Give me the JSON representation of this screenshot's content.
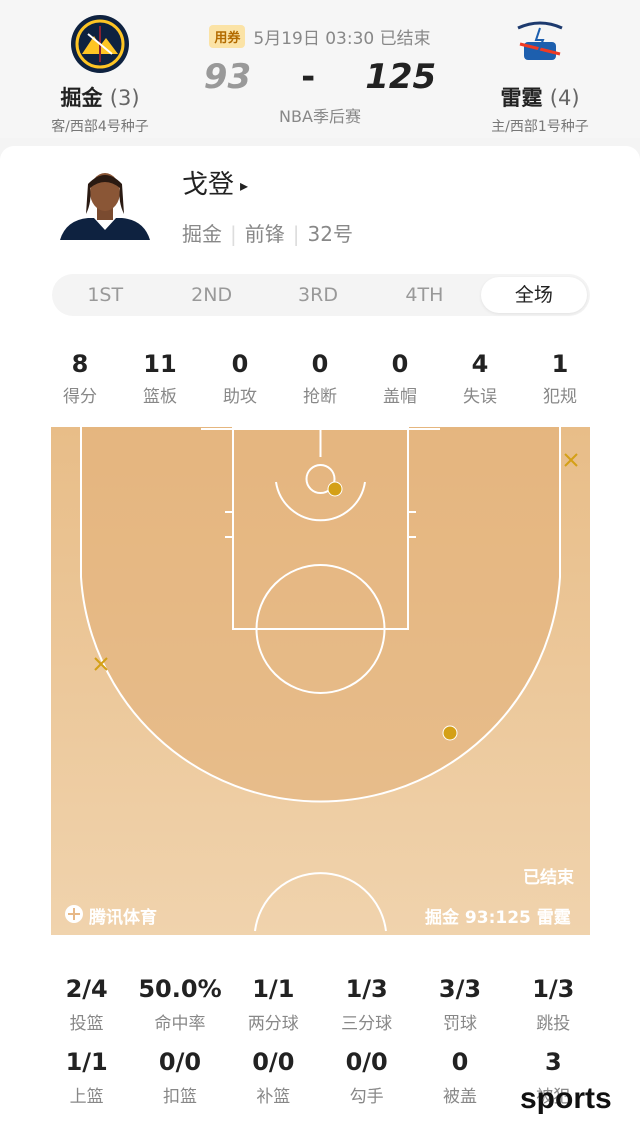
{
  "header": {
    "away": {
      "name": "掘金",
      "seed_count": "(3)",
      "sub": "客/西部4号种子",
      "logo_text": "DENVER NUGGETS"
    },
    "home": {
      "name": "雷霆",
      "seed_count": "(4)",
      "sub": "主/西部1号种子",
      "logo_text": "THUNDER"
    },
    "coupon": "用券",
    "datetime": "5月19日 03:30 已结束",
    "away_score": "93",
    "dash": "-",
    "home_score": "125",
    "league": "NBA季后赛"
  },
  "player": {
    "name": "戈登",
    "arrow": "▸",
    "team": "掘金",
    "position": "前锋",
    "number": "32号",
    "sep": "|"
  },
  "tabs": [
    "1ST",
    "2ND",
    "3RD",
    "4TH",
    "全场"
  ],
  "stats": [
    {
      "value": "8",
      "label": "得分"
    },
    {
      "value": "11",
      "label": "篮板"
    },
    {
      "value": "0",
      "label": "助攻"
    },
    {
      "value": "0",
      "label": "抢断"
    },
    {
      "value": "0",
      "label": "盖帽"
    },
    {
      "value": "4",
      "label": "失误"
    },
    {
      "value": "1",
      "label": "犯规"
    }
  ],
  "court": {
    "status": "已结束",
    "brand": "腾讯体育",
    "score_line": "掘金 93:125 雷霆",
    "made_color": "#d4a017",
    "missed_color": "#d4a017"
  },
  "shooting_row1": [
    {
      "value": "2/4",
      "label": "投篮"
    },
    {
      "value": "50.0%",
      "label": "命中率"
    },
    {
      "value": "1/1",
      "label": "两分球"
    },
    {
      "value": "1/3",
      "label": "三分球"
    },
    {
      "value": "3/3",
      "label": "罚球"
    },
    {
      "value": "1/3",
      "label": "跳投"
    }
  ],
  "shooting_row2": [
    {
      "value": "1/1",
      "label": "上篮"
    },
    {
      "value": "0/0",
      "label": "扣篮"
    },
    {
      "value": "0/0",
      "label": "补篮"
    },
    {
      "value": "0/0",
      "label": "勾手"
    },
    {
      "value": "0",
      "label": "被盖"
    },
    {
      "value": "3",
      "label": "被犯"
    }
  ],
  "watermark": "sports"
}
